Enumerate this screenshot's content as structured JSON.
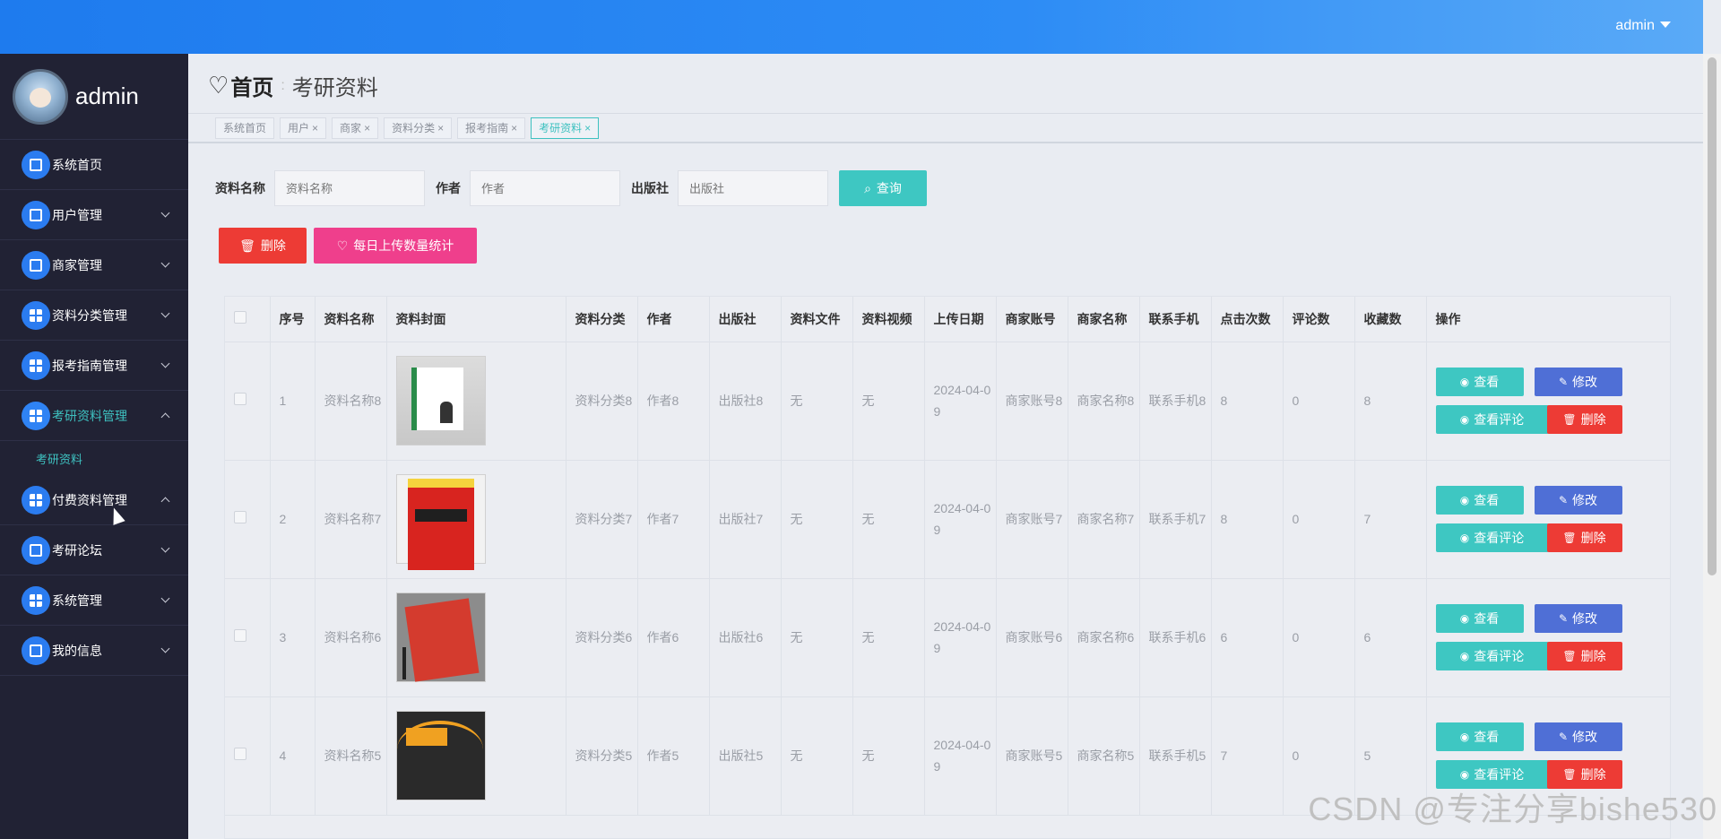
{
  "topbar": {
    "user": "admin"
  },
  "sidebar": {
    "username": "admin",
    "items": [
      {
        "label": "系统首页"
      },
      {
        "label": "用户管理"
      },
      {
        "label": "商家管理"
      },
      {
        "label": "资料分类管理"
      },
      {
        "label": "报考指南管理"
      },
      {
        "label": "考研资料管理"
      },
      {
        "label": "付费资料管理"
      },
      {
        "label": "考研论坛"
      },
      {
        "label": "系统管理"
      },
      {
        "label": "我的信息"
      }
    ],
    "submenu": "考研资料"
  },
  "breadcrumb": {
    "home": "首页",
    "sep": ":",
    "current": "考研资料"
  },
  "tabs": [
    {
      "label": "系统首页",
      "close": ""
    },
    {
      "label": "用户",
      "close": "×"
    },
    {
      "label": "商家",
      "close": "×"
    },
    {
      "label": "资料分类",
      "close": "×"
    },
    {
      "label": "报考指南",
      "close": "×"
    },
    {
      "label": "考研资料",
      "close": "×"
    }
  ],
  "search": {
    "name_label": "资料名称",
    "name_placeholder": "资料名称",
    "author_label": "作者",
    "author_placeholder": "作者",
    "publisher_label": "出版社",
    "publisher_placeholder": "出版社",
    "query": "查询"
  },
  "actions": {
    "delete": "删除",
    "stat": "每日上传数量统计"
  },
  "table": {
    "headers": [
      "序号",
      "资料名称",
      "资料封面",
      "资料分类",
      "作者",
      "出版社",
      "资料文件",
      "资料视频",
      "上传日期",
      "商家账号",
      "商家名称",
      "联系手机",
      "点击次数",
      "评论数",
      "收藏数",
      "操作"
    ],
    "ops": {
      "view": "查看",
      "edit": "修改",
      "comment": "查看评论",
      "delete": "删除"
    },
    "rows": [
      {
        "no": "1",
        "name": "资料名称8",
        "cat": "资料分类8",
        "author": "作者8",
        "pub": "出版社8",
        "file": "无",
        "video": "无",
        "date": "2024-04-09",
        "acct": "商家账号8",
        "mname": "商家名称8",
        "phone": "联系手机8",
        "clicks": "8",
        "comments": "0",
        "favs": "8"
      },
      {
        "no": "2",
        "name": "资料名称7",
        "cat": "资料分类7",
        "author": "作者7",
        "pub": "出版社7",
        "file": "无",
        "video": "无",
        "date": "2024-04-09",
        "acct": "商家账号7",
        "mname": "商家名称7",
        "phone": "联系手机7",
        "clicks": "8",
        "comments": "0",
        "favs": "7"
      },
      {
        "no": "3",
        "name": "资料名称6",
        "cat": "资料分类6",
        "author": "作者6",
        "pub": "出版社6",
        "file": "无",
        "video": "无",
        "date": "2024-04-09",
        "acct": "商家账号6",
        "mname": "商家名称6",
        "phone": "联系手机6",
        "clicks": "6",
        "comments": "0",
        "favs": "6"
      },
      {
        "no": "4",
        "name": "资料名称5",
        "cat": "资料分类5",
        "author": "作者5",
        "pub": "出版社5",
        "file": "无",
        "video": "无",
        "date": "2024-04-09",
        "acct": "商家账号5",
        "mname": "商家名称5",
        "phone": "联系手机5",
        "clicks": "7",
        "comments": "0",
        "favs": "5"
      }
    ]
  },
  "watermark": "CSDN @专注分享bishe530"
}
